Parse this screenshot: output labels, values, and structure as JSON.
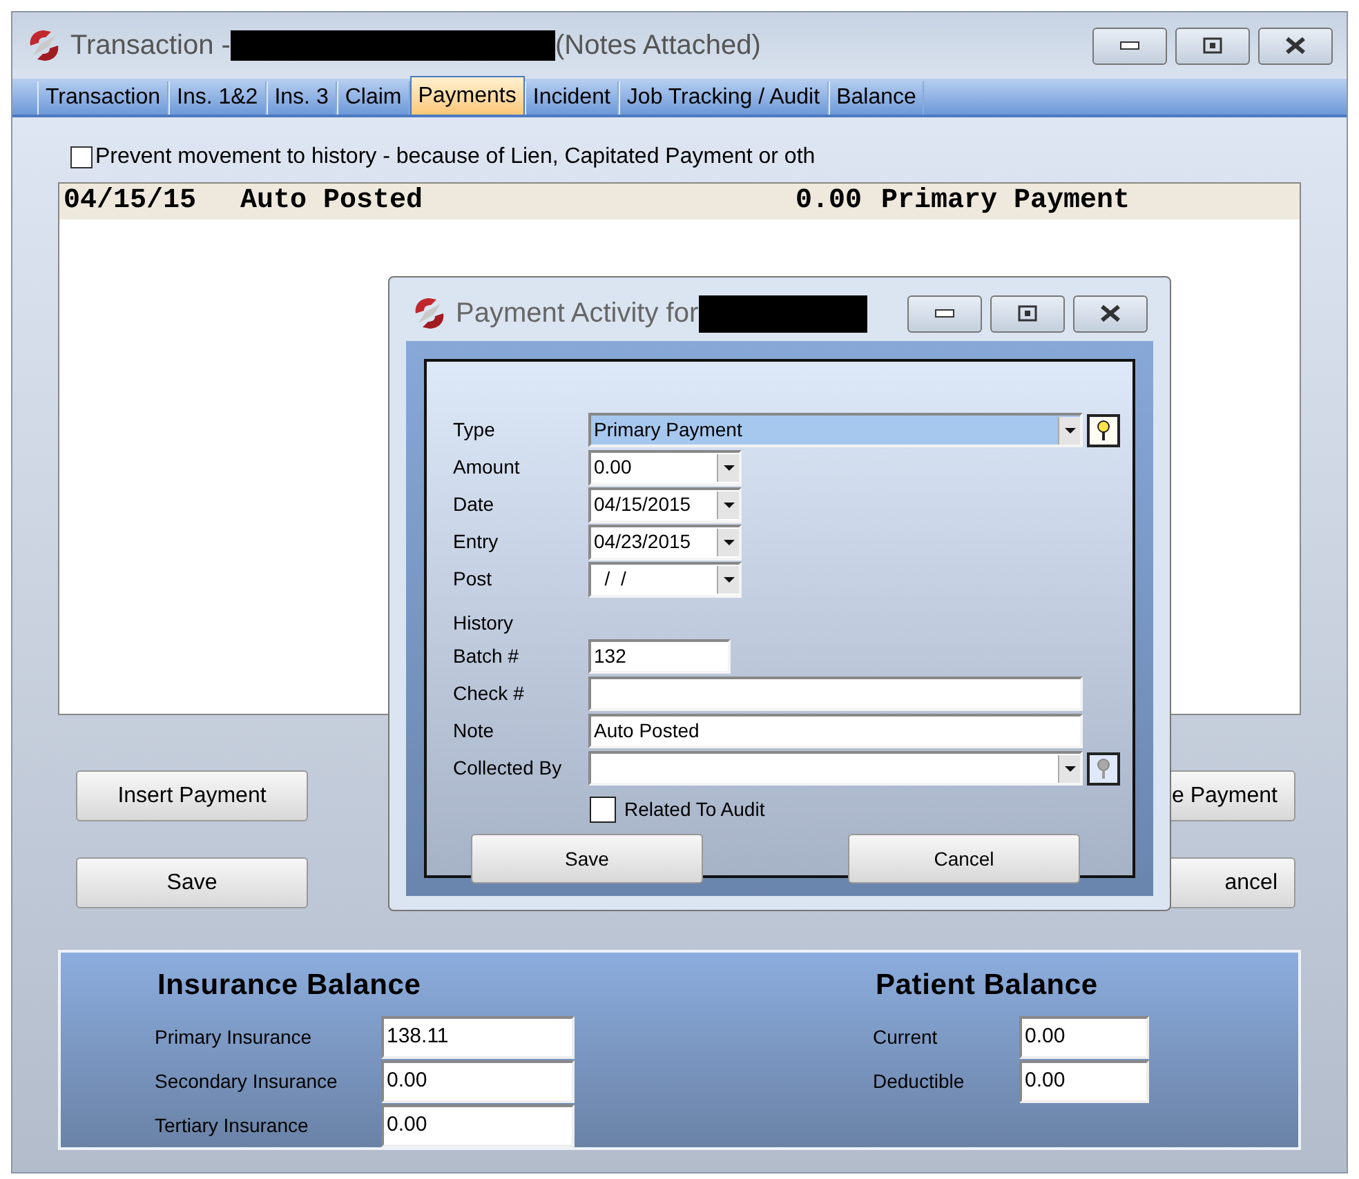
{
  "window": {
    "title": "Transaction -",
    "title_suffix": "(Notes Attached)"
  },
  "tabs": [
    {
      "label": "Transaction",
      "selected": false
    },
    {
      "label": "Ins. 1&2",
      "selected": false
    },
    {
      "label": "Ins. 3",
      "selected": false
    },
    {
      "label": "Claim",
      "selected": false
    },
    {
      "label": "Payments",
      "selected": true
    },
    {
      "label": "Incident",
      "selected": false
    },
    {
      "label": "Job Tracking / Audit",
      "selected": false
    },
    {
      "label": "Balance",
      "selected": false
    }
  ],
  "prevent_history": {
    "label": "Prevent movement to history - because of Lien, Capitated Payment or oth",
    "checked": false
  },
  "payments": [
    {
      "date": "04/15/15",
      "note": "Auto Posted",
      "amount": "0.00",
      "type": "Primary Payment",
      "selected": true
    }
  ],
  "left_buttons": [
    "Insert Payment",
    "Save"
  ],
  "right_buttons": [
    "e Payment",
    "ancel"
  ],
  "insurance_balance": {
    "title": "Insurance Balance",
    "rows": [
      {
        "label": "Primary Insurance",
        "value": "138.11"
      },
      {
        "label": "Secondary Insurance",
        "value": "0.00"
      },
      {
        "label": "Tertiary Insurance",
        "value": "0.00"
      }
    ]
  },
  "patient_balance": {
    "title": "Patient Balance",
    "rows": [
      {
        "label": "Current",
        "value": "0.00"
      },
      {
        "label": "Deductible",
        "value": "0.00"
      }
    ]
  },
  "dialog": {
    "title": "Payment Activity for",
    "fields": [
      {
        "kind": "wide-combo",
        "label": "Type",
        "value": "Primary Payment",
        "highlighted": true,
        "lookup_enabled": true
      },
      {
        "kind": "combo",
        "label": "Amount",
        "value": "0.00"
      },
      {
        "kind": "combo",
        "label": "Date",
        "value": "04/15/2015"
      },
      {
        "kind": "combo",
        "label": "Entry",
        "value": "04/23/2015"
      },
      {
        "kind": "combo",
        "label": "Post",
        "value": "  /  /"
      },
      {
        "kind": "heading",
        "label": "History"
      },
      {
        "kind": "short-text",
        "label": "Batch #",
        "value": "132"
      },
      {
        "kind": "text",
        "label": "Check #"
      },
      {
        "kind": "text",
        "label": "Note",
        "value": "Auto Posted"
      },
      {
        "kind": "wide-combo",
        "label": "Collected By",
        "highlighted": false,
        "lookup_enabled": false
      }
    ],
    "related_to_audit": {
      "label": "Related To Audit",
      "checked": false
    },
    "buttons": [
      "Save",
      "Cancel"
    ]
  }
}
